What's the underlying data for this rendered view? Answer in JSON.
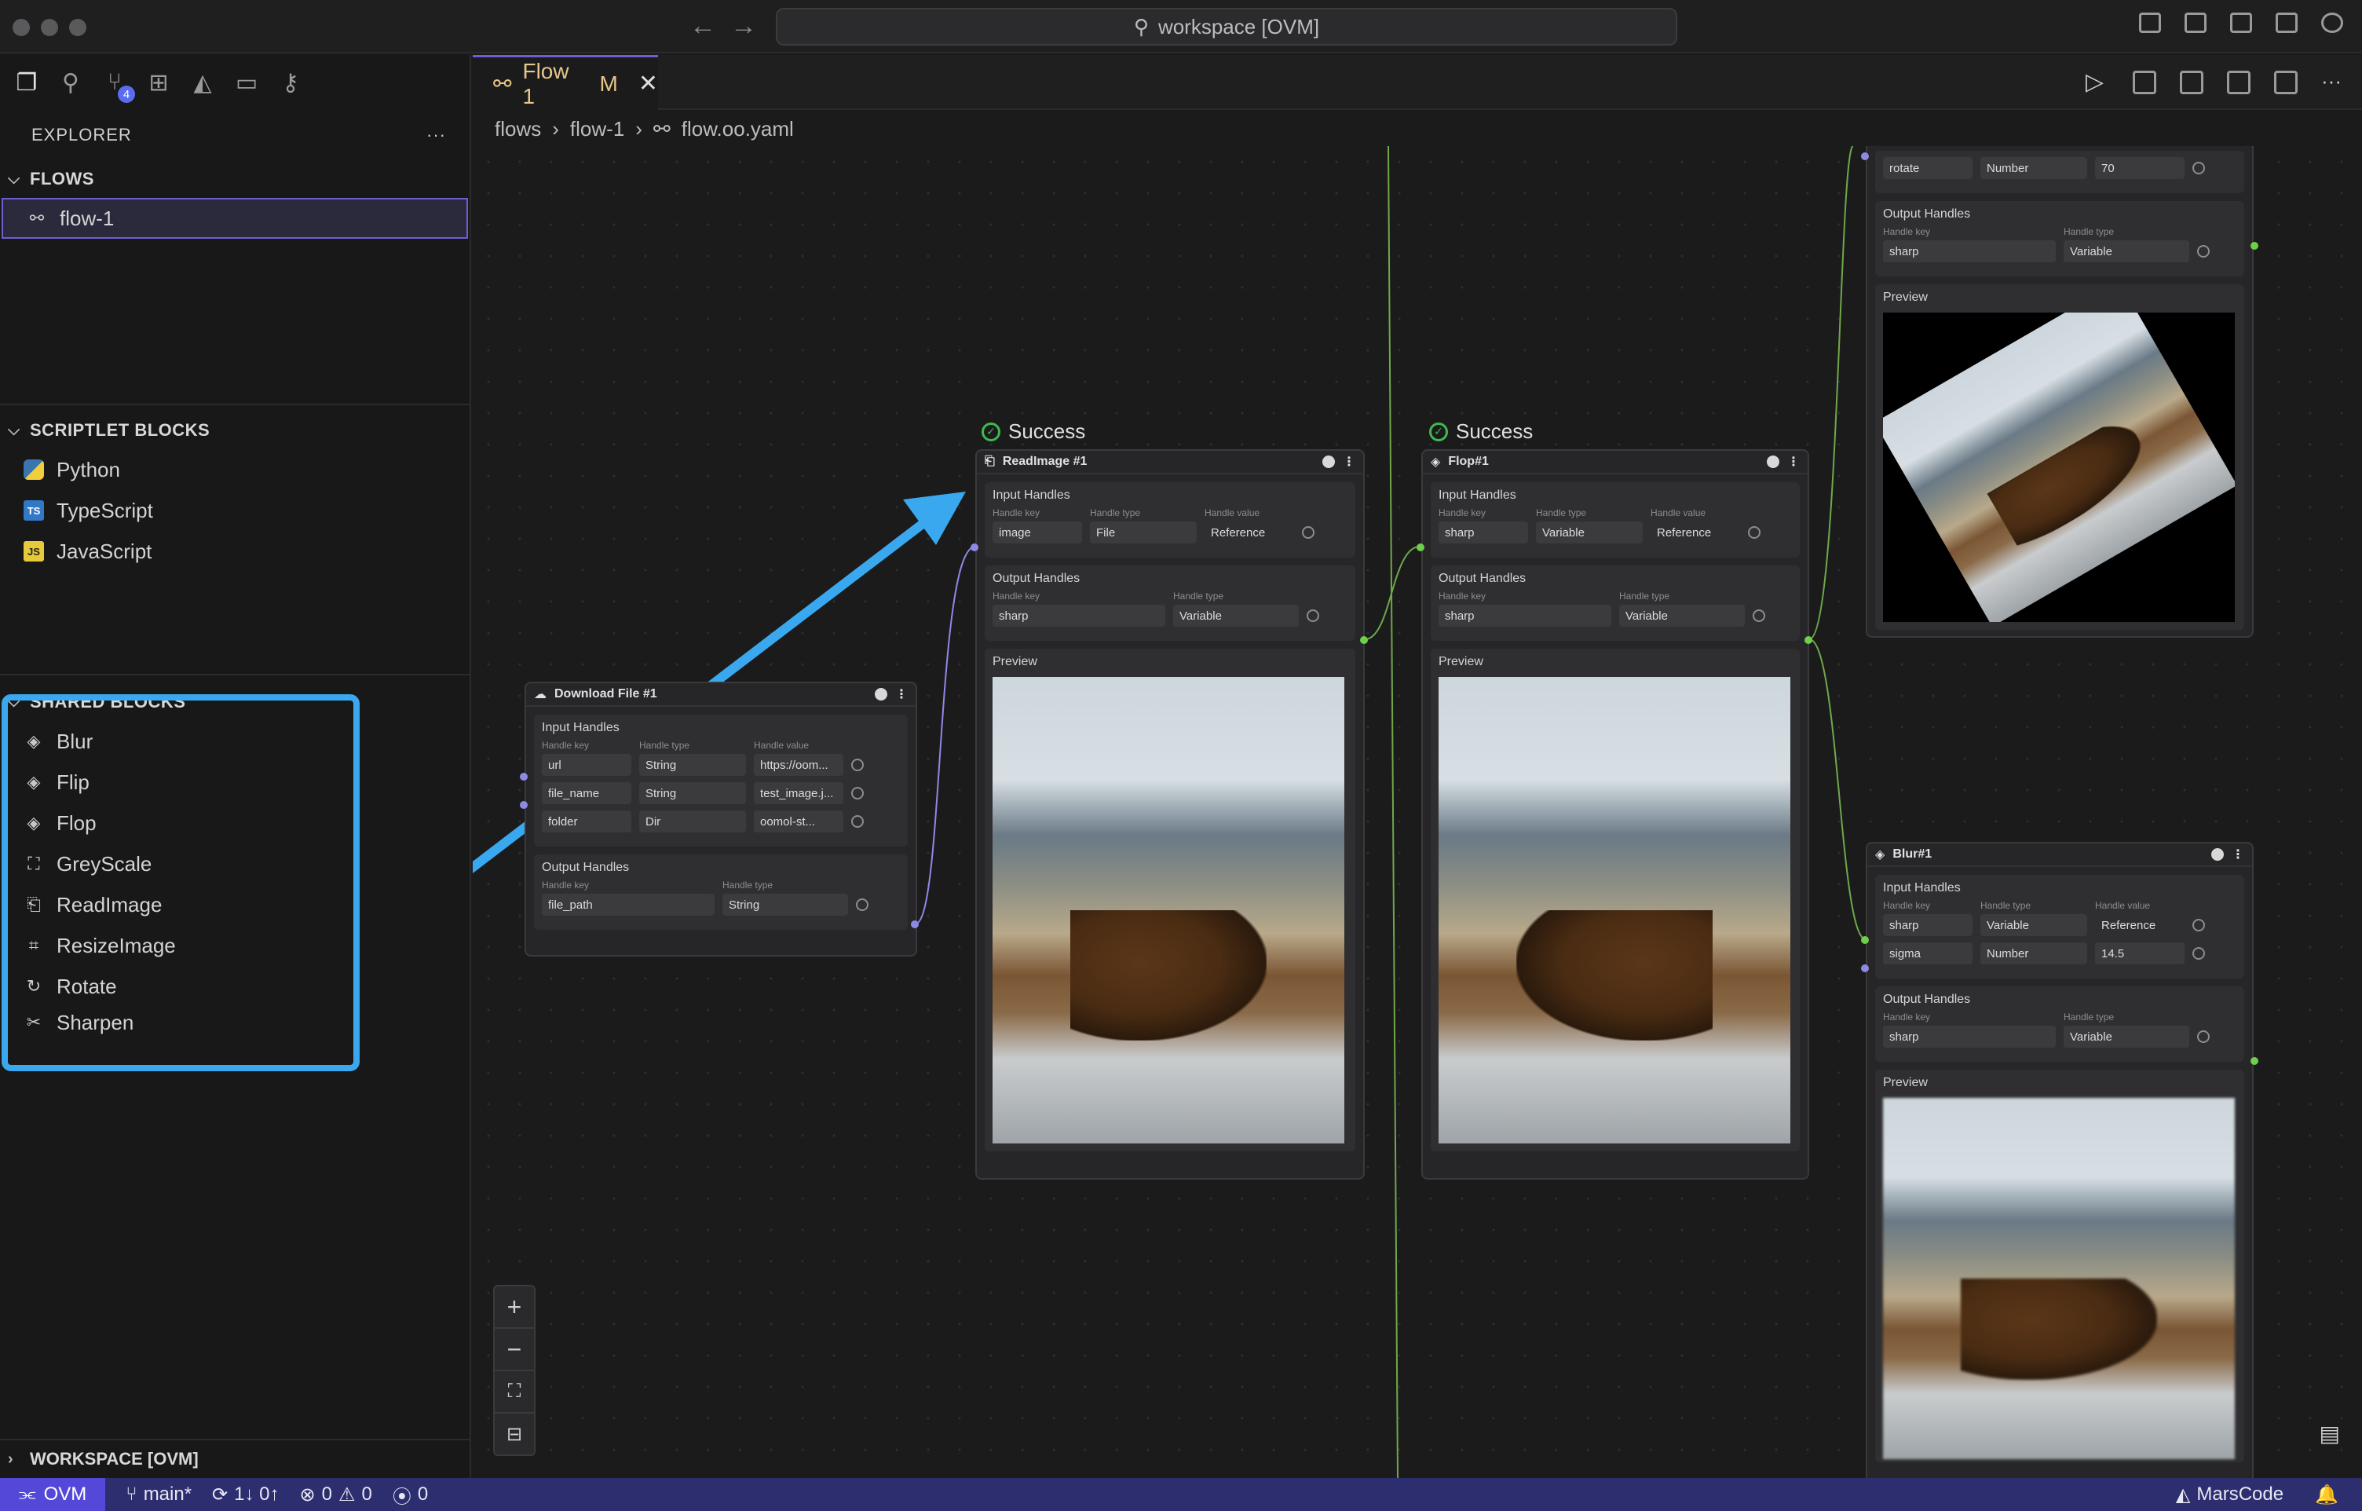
{
  "window": {
    "search_text": "workspace [OVM]"
  },
  "sidebar": {
    "explorer_title": "EXPLORER",
    "more_label": "···",
    "source_control_badge": "4",
    "flows": {
      "title": "FLOWS",
      "items": [
        {
          "label": "flow-1"
        }
      ]
    },
    "scriptlet_blocks": {
      "title": "SCRIPTLET BLOCKS",
      "items": [
        {
          "label": "Python"
        },
        {
          "label": "TypeScript",
          "badge": "TS"
        },
        {
          "label": "JavaScript",
          "badge": "JS"
        }
      ]
    },
    "shared_blocks": {
      "title": "SHARED BLOCKS",
      "items": [
        {
          "label": "Blur"
        },
        {
          "label": "Flip"
        },
        {
          "label": "Flop"
        },
        {
          "label": "GreyScale"
        },
        {
          "label": "ReadImage"
        },
        {
          "label": "ResizeImage"
        },
        {
          "label": "Rotate"
        },
        {
          "label": "Sharpen"
        }
      ]
    },
    "workspace_footer": "WORKSPACE [OVM]"
  },
  "editor": {
    "tab": {
      "label": "Flow 1",
      "modified": "M",
      "close": "✕"
    },
    "breadcrumb": [
      "flows",
      "flow-1",
      "flow.oo.yaml"
    ]
  },
  "canvas": {
    "labels": {
      "input_handles": "Input Handles",
      "output_handles": "Output Handles",
      "preview": "Preview",
      "handle_key": "Handle key",
      "handle_type": "Handle type",
      "handle_value": "Handle value",
      "success": "Success"
    },
    "download_node": {
      "title": "Download File #1",
      "inputs": [
        {
          "key": "url",
          "type": "String",
          "value": "https://oom..."
        },
        {
          "key": "file_name",
          "type": "String",
          "value": "test_image.j..."
        },
        {
          "key": "folder",
          "type": "Dir",
          "value": "oomol-st..."
        }
      ],
      "outputs": [
        {
          "key": "file_path",
          "type": "String"
        }
      ]
    },
    "readimage_node": {
      "title": "ReadImage #1",
      "inputs": [
        {
          "key": "image",
          "type": "File",
          "value": "Reference"
        }
      ],
      "outputs": [
        {
          "key": "sharp",
          "type": "Variable"
        }
      ]
    },
    "flop_node": {
      "title": "Flop#1",
      "inputs": [
        {
          "key": "sharp",
          "type": "Variable",
          "value": "Reference"
        }
      ],
      "outputs": [
        {
          "key": "sharp",
          "type": "Variable"
        }
      ]
    },
    "rotate_node": {
      "inputs": [
        {
          "key": "rotate",
          "type": "Number",
          "value": "70"
        }
      ],
      "outputs": [
        {
          "key": "sharp",
          "type": "Variable"
        }
      ]
    },
    "blur_node": {
      "title": "Blur#1",
      "inputs": [
        {
          "key": "sharp",
          "type": "Variable",
          "value": "Reference"
        },
        {
          "key": "sigma",
          "type": "Number",
          "value": "14.5"
        }
      ],
      "outputs": [
        {
          "key": "sharp",
          "type": "Variable"
        }
      ]
    }
  },
  "statusbar": {
    "remote": "OVM",
    "branch": "main*",
    "sync": "1↓ 0↑",
    "errors": "0",
    "warnings": "0",
    "ports": "0",
    "brand": "MarsCode"
  },
  "colors": {
    "accent": "#6b5fd6",
    "highlight": "#3aa8ef",
    "success": "#3fb950",
    "statusbar": "#2d2e70"
  }
}
